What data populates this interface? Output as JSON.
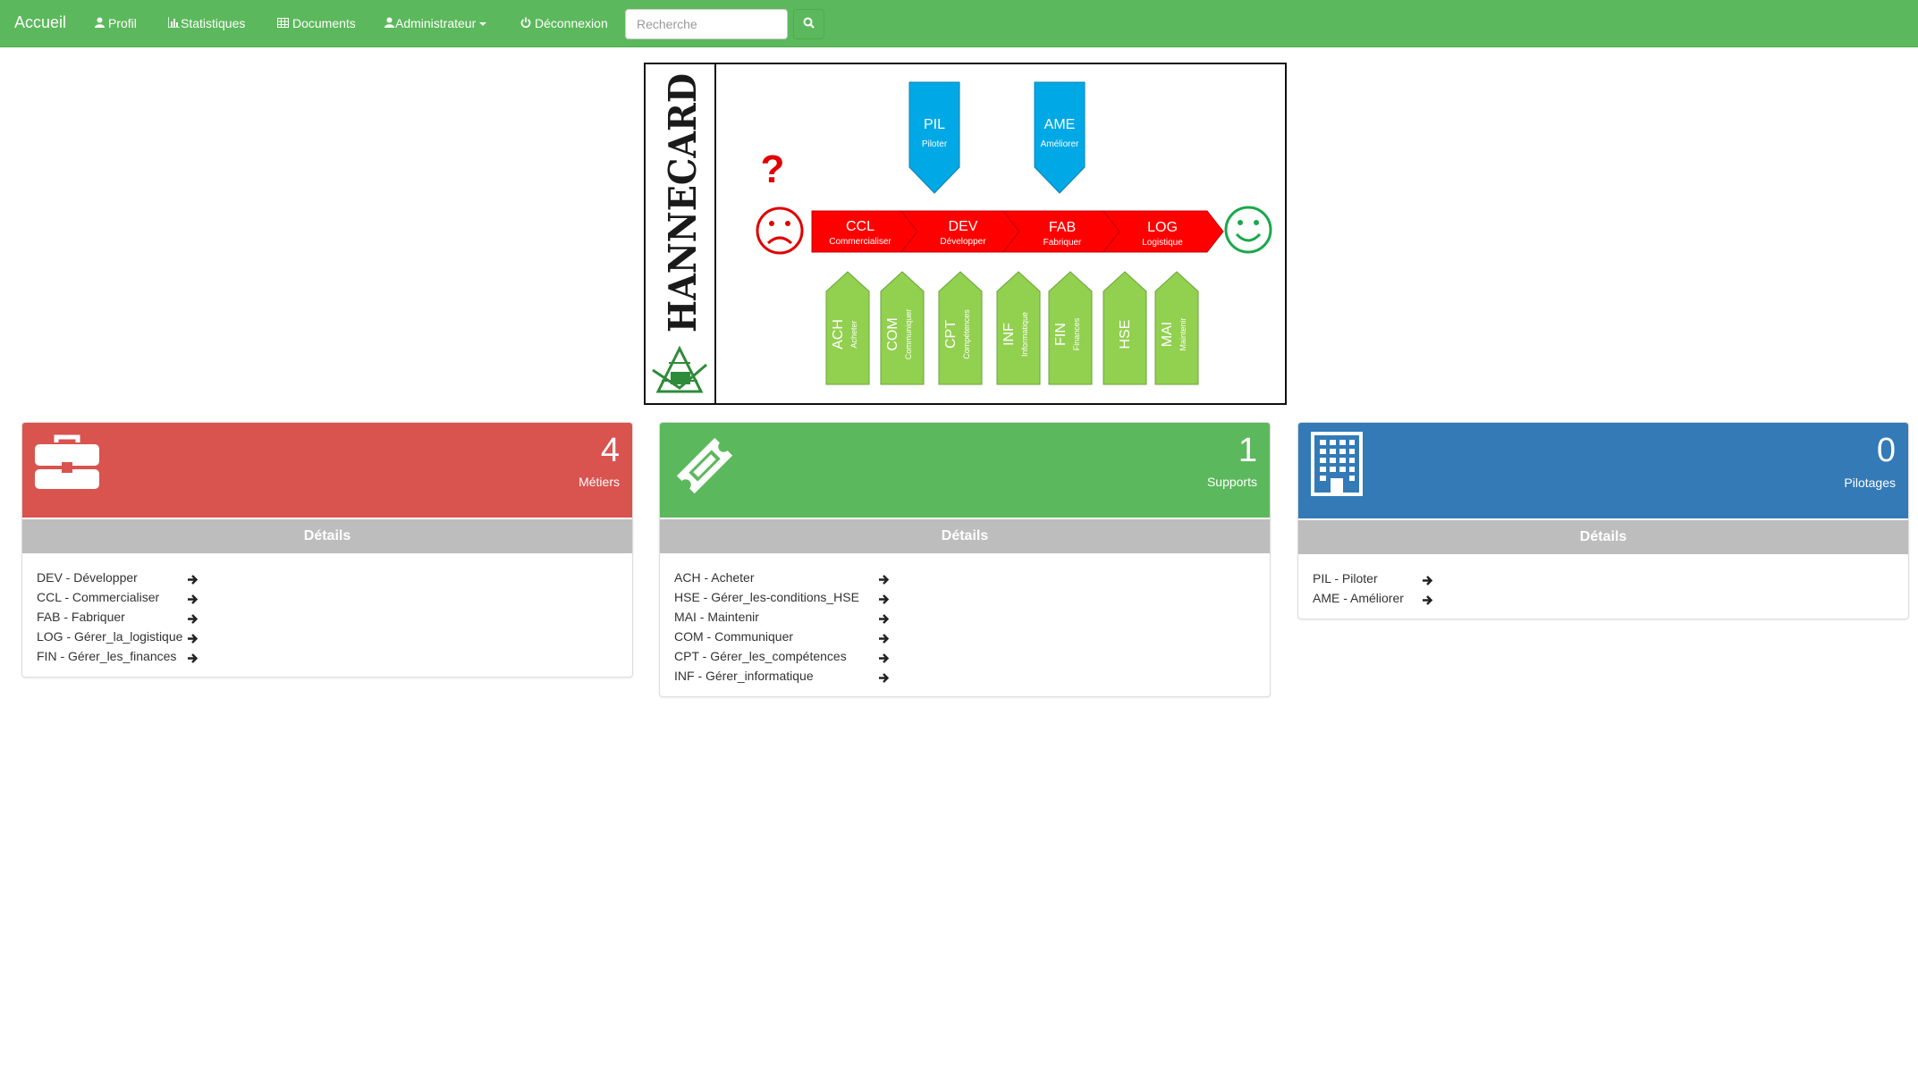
{
  "navbar": {
    "brand": "Accueil",
    "items": [
      {
        "label": "Profil",
        "icon": "user-icon"
      },
      {
        "label": "Statistiques",
        "icon": "bar-chart-icon"
      },
      {
        "label": "Documents",
        "icon": "table-icon"
      },
      {
        "label": "Administrateur",
        "icon": "user-icon"
      },
      {
        "label": "Déconnexion",
        "icon": "power-icon"
      }
    ],
    "search_placeholder": "Recherche",
    "color": "#5cb85c"
  },
  "diagram": {
    "company": "HANNECARD",
    "top_arrows": [
      {
        "code": "PIL",
        "name": "Piloter"
      },
      {
        "code": "AME",
        "name": "Améliorer"
      }
    ],
    "chain": [
      {
        "code": "CCL",
        "name": "Commercialiser"
      },
      {
        "code": "DEV",
        "name": "Développer"
      },
      {
        "code": "FAB",
        "name": "Fabriquer"
      },
      {
        "code": "LOG",
        "name": "Logistique"
      }
    ],
    "support": [
      {
        "code": "ACH",
        "name": "Acheter"
      },
      {
        "code": "COM",
        "name": "Communiquer"
      },
      {
        "code": "CPT",
        "name": "Compétences"
      },
      {
        "code": "INF",
        "name": "Informatique"
      },
      {
        "code": "FIN",
        "name": "Finances"
      },
      {
        "code": "HSE",
        "name": ""
      },
      {
        "code": "MAI",
        "name": "Maintenir"
      }
    ],
    "question_mark": "?"
  },
  "panels": [
    {
      "count": "4",
      "label": "Métiers",
      "details": "Détails",
      "color": "#d9534f",
      "icon": "briefcase-icon",
      "items": [
        "DEV - Développer",
        "CCL - Commercialiser",
        "FAB - Fabriquer",
        "LOG - Gérer_la_logistique",
        "FIN - Gérer_les_finances"
      ]
    },
    {
      "count": "1",
      "label": "Supports",
      "details": "Détails",
      "color": "#5cb85c",
      "icon": "ticket-icon",
      "items": [
        "ACH - Acheter",
        "HSE - Gérer_les-conditions_HSE",
        "MAI - Maintenir",
        "COM - Communiquer",
        "CPT - Gérer_les_compétences",
        "INF - Gérer_informatique"
      ]
    },
    {
      "count": "0",
      "label": "Pilotages",
      "details": "Détails",
      "color": "#337ab7",
      "icon": "building-icon",
      "items": [
        "PIL - Piloter",
        "AME - Améliorer"
      ]
    }
  ]
}
